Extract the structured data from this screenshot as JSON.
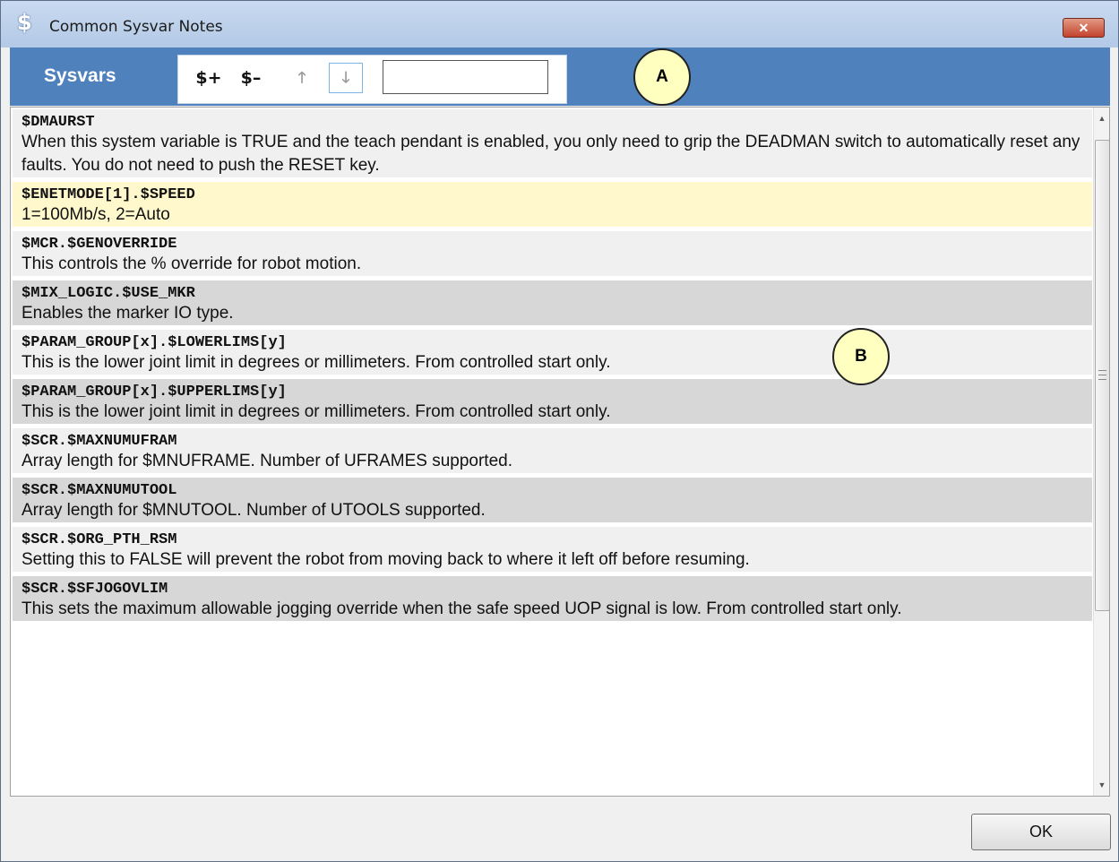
{
  "window": {
    "title": "Common Sysvar Notes",
    "icon": "dollar-icon",
    "close_label": "✕"
  },
  "toolbar": {
    "label": "Sysvars",
    "add_label": "$+",
    "remove_label": "$–",
    "move_up_icon": "arrow-up-icon",
    "move_down_icon": "arrow-down-icon",
    "filter_value": ""
  },
  "callouts": {
    "a": "A",
    "b": "B"
  },
  "colors": {
    "toolbar_bg": "#4f81bd",
    "selected_row": "#fff8cc",
    "row_light": "#f0f0f0",
    "row_dark": "#d7d7d7",
    "callout_fill": "#ffffc0"
  },
  "sysvars": [
    {
      "name": "$DMAURST",
      "description": "When this system variable is TRUE and the teach pendant is enabled, you only need to grip the DEADMAN switch to automatically reset any faults. You do not need to push the RESET key.",
      "selected": false
    },
    {
      "name": "$ENETMODE[1].$SPEED",
      "description": "1=100Mb/s,  2=Auto",
      "selected": true
    },
    {
      "name": "$MCR.$GENOVERRIDE",
      "description": "This controls the % override for robot motion.",
      "selected": false
    },
    {
      "name": "$MIX_LOGIC.$USE_MKR",
      "description": "Enables the marker IO type.",
      "selected": false
    },
    {
      "name": "$PARAM_GROUP[x].$LOWERLIMS[y]",
      "description": "This is the lower joint limit in degrees or millimeters. From controlled start only.",
      "selected": false
    },
    {
      "name": "$PARAM_GROUP[x].$UPPERLIMS[y]",
      "description": "This is the lower joint limit in degrees or millimeters. From controlled start only.",
      "selected": false
    },
    {
      "name": "$SCR.$MAXNUMUFRAM",
      "description": "Array length for $MNUFRAME.  Number of UFRAMES supported.",
      "selected": false
    },
    {
      "name": "$SCR.$MAXNUMUTOOL",
      "description": "Array length for $MNUTOOL.  Number of UTOOLS supported.",
      "selected": false
    },
    {
      "name": "$SCR.$ORG_PTH_RSM",
      "description": "Setting this to FALSE will prevent the robot from moving back to where it left off before resuming.",
      "selected": false
    },
    {
      "name": "$SCR.$SFJOGOVLIM",
      "description": "This sets the maximum allowable jogging override when the safe speed UOP signal is low.  From controlled start only.",
      "selected": false
    }
  ],
  "buttons": {
    "ok_label": "OK"
  }
}
